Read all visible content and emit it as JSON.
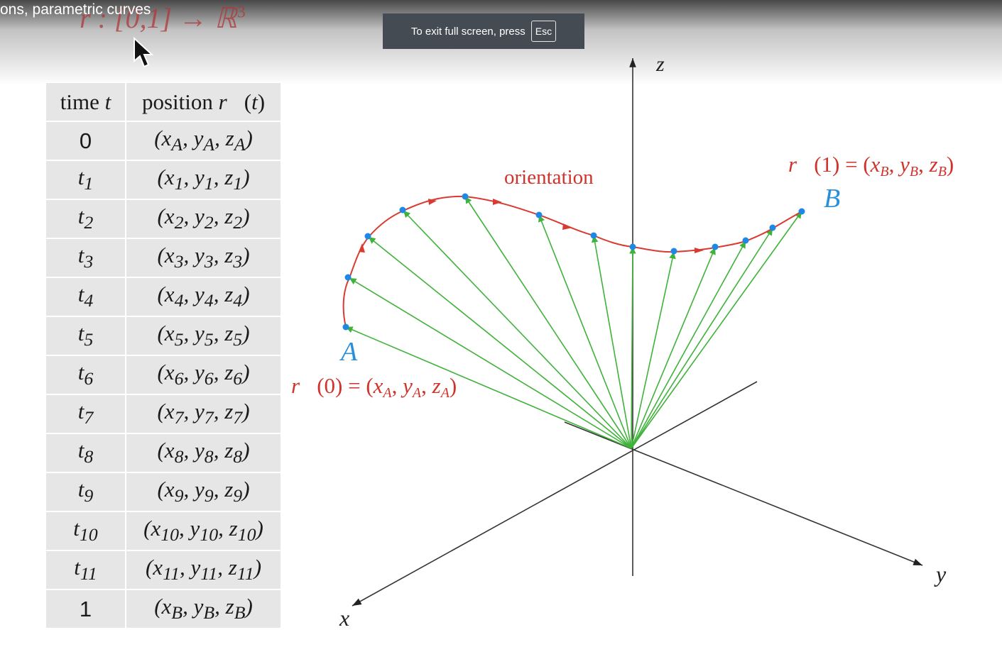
{
  "header": {
    "video_title": "ons, parametric curves",
    "function_signature": "r : [0,1] → ℝ",
    "function_signature_exp": "3"
  },
  "fullscreen_notice": {
    "text": "To exit full screen, press",
    "key": "Esc"
  },
  "table": {
    "headers": [
      "time t",
      "position r⃗(t)"
    ],
    "rows": [
      {
        "t": "0",
        "position": "(xA, yA, zA)"
      },
      {
        "t": "t1",
        "position": "(x1, y1, z1)"
      },
      {
        "t": "t2",
        "position": "(x2, y2, z2)"
      },
      {
        "t": "t3",
        "position": "(x3, y3, z3)"
      },
      {
        "t": "t4",
        "position": "(x4, y4, z4)"
      },
      {
        "t": "t5",
        "position": "(x5, y5, z5)"
      },
      {
        "t": "t6",
        "position": "(x6, y6, z6)"
      },
      {
        "t": "t7",
        "position": "(x7, y7, z7)"
      },
      {
        "t": "t8",
        "position": "(x8, y8, z8)"
      },
      {
        "t": "t9",
        "position": "(x9, y9, z9)"
      },
      {
        "t": "t10",
        "position": "(x10, y10, z10)"
      },
      {
        "t": "t11",
        "position": "(x11, y11, z11)"
      },
      {
        "t": "1",
        "position": "(xB, yB, zB)"
      }
    ]
  },
  "diagram": {
    "axis_x": "x",
    "axis_y": "y",
    "axis_z": "z",
    "orientation_label": "orientation",
    "point_a": "A",
    "point_b": "B",
    "r0_label": "r⃗(0) = (xA, yA, zA)",
    "r1_label": "r⃗(1) = (xB, yB, zB)"
  },
  "colors": {
    "curve": "#d93a32",
    "vectors": "#3fb23a",
    "points": "#1e88e5",
    "text_red": "#d0332b",
    "text_blue": "#2a8fd8"
  }
}
